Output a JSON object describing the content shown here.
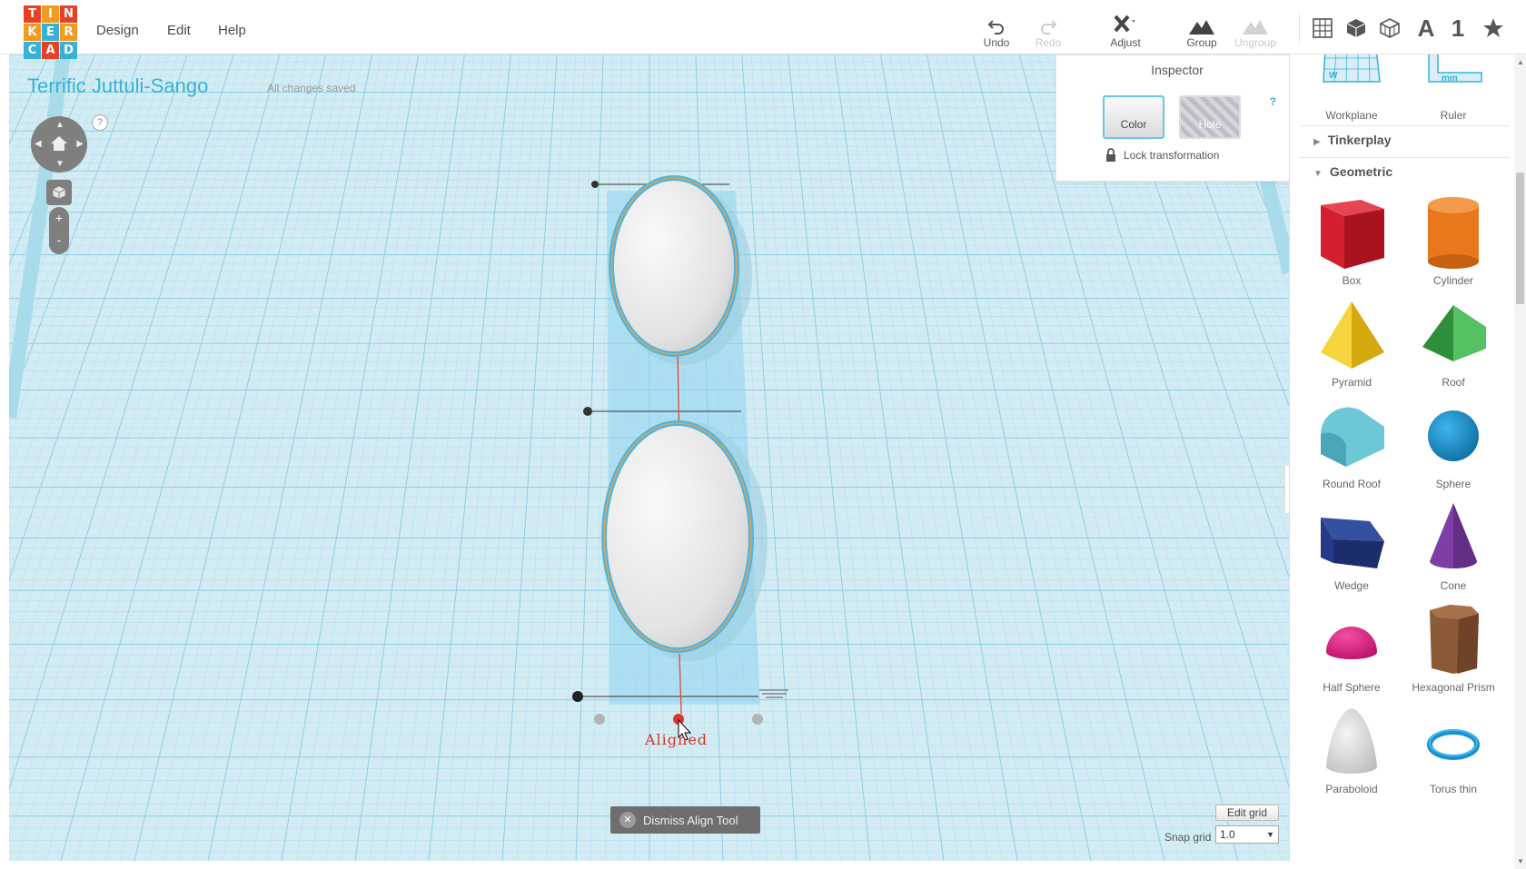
{
  "app": {
    "logo_letters": [
      "T",
      "I",
      "N",
      "K",
      "E",
      "R",
      "C",
      "A",
      "D"
    ],
    "logo_colors": [
      "#e74025",
      "#f29b22",
      "#e74025",
      "#f29b22",
      "#37b2d6",
      "#f29b22",
      "#37b2d6",
      "#e74025",
      "#37b2d6"
    ]
  },
  "menu": [
    "Design",
    "Edit",
    "Help"
  ],
  "toolbar": {
    "undo": "Undo",
    "redo": "Redo",
    "adjust": "Adjust",
    "group": "Group",
    "ungroup": "Ungroup",
    "view_number": "1",
    "view_letter": "A"
  },
  "project": {
    "title": "Terrific Juttuli-Sango",
    "status": "All changes saved"
  },
  "nav": {
    "help": "?",
    "zoom_in": "+",
    "zoom_out": "-"
  },
  "inspector": {
    "title": "Inspector",
    "color_label": "Color",
    "hole_label": "Hole",
    "help": "?",
    "lock_label": "Lock transformation"
  },
  "align": {
    "status": "Aligned",
    "dismiss_label": "Dismiss Align Tool"
  },
  "grid": {
    "edit_label": "Edit grid",
    "snap_label": "Snap grid",
    "snap_value": "1.0"
  },
  "panel": {
    "top_items": [
      {
        "label": "Workplane",
        "icon": "workplane-icon"
      },
      {
        "label": "Ruler",
        "icon": "ruler-icon"
      }
    ],
    "sections": [
      {
        "label": "Tinkerplay",
        "expanded": false
      },
      {
        "label": "Geometric",
        "expanded": true
      }
    ],
    "shapes": [
      {
        "label": "Box",
        "color": "#d41f2e"
      },
      {
        "label": "Cylinder",
        "color": "#e9771c"
      },
      {
        "label": "Pyramid",
        "color": "#f0c419"
      },
      {
        "label": "Roof",
        "color": "#3da94a"
      },
      {
        "label": "Round Roof",
        "color": "#6cc7d6"
      },
      {
        "label": "Sphere",
        "color": "#1792d0"
      },
      {
        "label": "Wedge",
        "color": "#243b8a"
      },
      {
        "label": "Cone",
        "color": "#7d3fa6"
      },
      {
        "label": "Half Sphere",
        "color": "#e0177f"
      },
      {
        "label": "Hexagonal Prism",
        "color": "#8b5a36"
      },
      {
        "label": "Paraboloid",
        "color": "#d9d9d9"
      },
      {
        "label": "Torus thin",
        "color": "#1792d0"
      }
    ]
  }
}
